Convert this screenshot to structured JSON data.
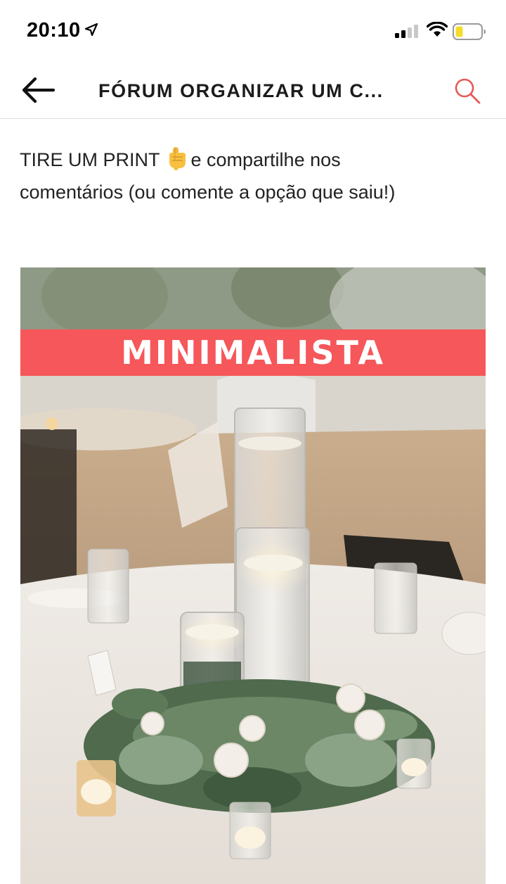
{
  "status_bar": {
    "time": "20:10",
    "icons": [
      "location-arrow-icon",
      "signal-icon",
      "wifi-icon",
      "battery-icon"
    ]
  },
  "header": {
    "back_icon": "arrow-left-icon",
    "title": "FÓRUM ORGANIZAR UM C...",
    "search_icon": "search-icon"
  },
  "post": {
    "line1_before": "TIRE UM PRINT",
    "emoji": "hand-pointing-down-emoji",
    "line1_after": "e compartilhe nos",
    "line2": "comentários (ou comente a opção que saiu!)"
  },
  "image": {
    "label": "MINIMALISTA"
  },
  "colors": {
    "accent": "#f6575a",
    "search_icon": "#e8585a",
    "text": "#1c1c1c",
    "divider": "#dcdcdc"
  }
}
